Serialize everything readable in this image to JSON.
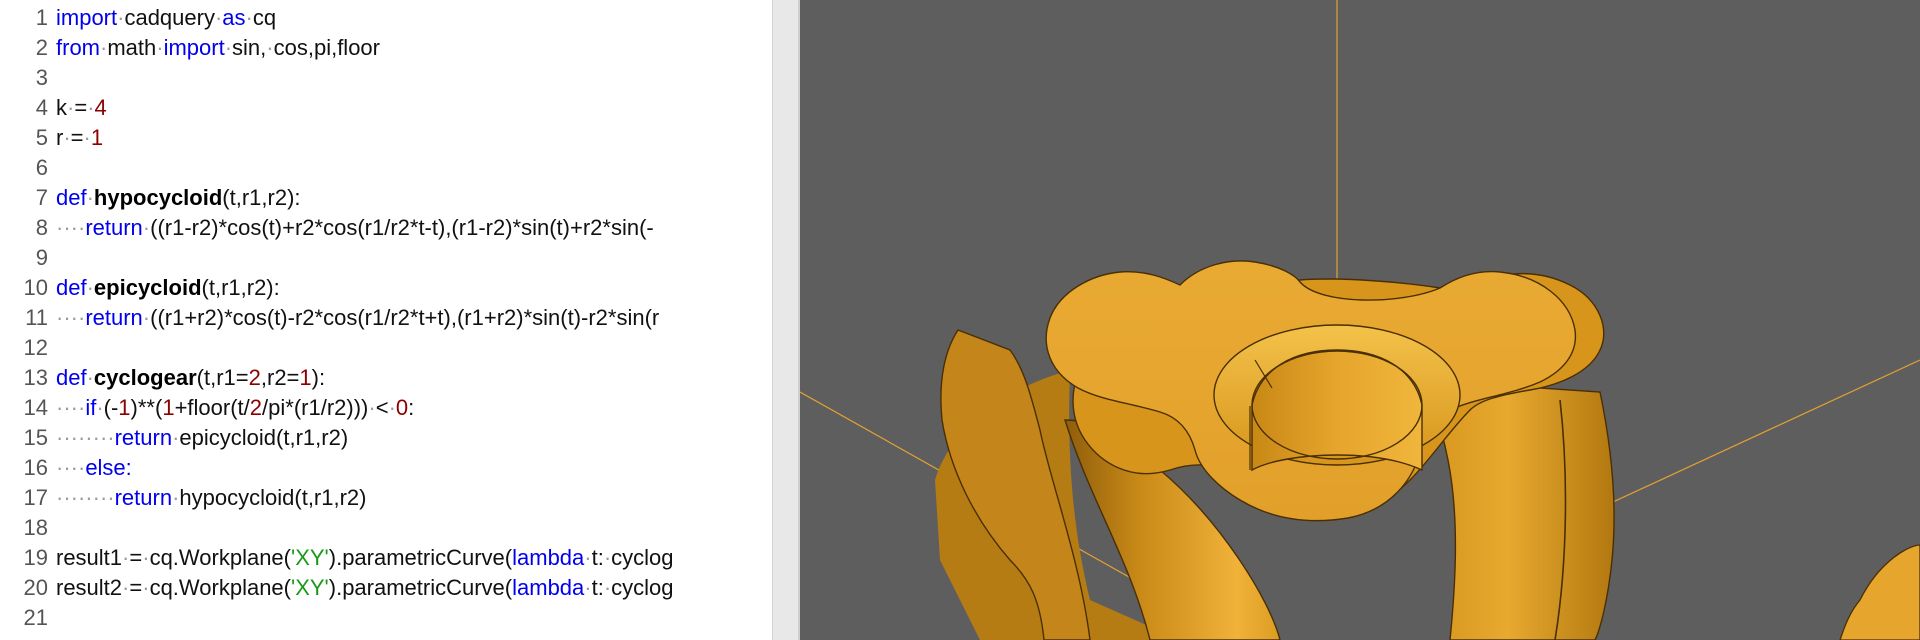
{
  "editor": {
    "lines": [
      {
        "num": "1",
        "tokens": [
          {
            "t": "import",
            "c": "kw"
          },
          {
            "t": "·",
            "c": "dot"
          },
          {
            "t": "cadquery"
          },
          {
            "t": "·",
            "c": "dot"
          },
          {
            "t": "as",
            "c": "kw"
          },
          {
            "t": "·",
            "c": "dot"
          },
          {
            "t": "cq"
          }
        ]
      },
      {
        "num": "2",
        "tokens": [
          {
            "t": "from",
            "c": "kw"
          },
          {
            "t": "·",
            "c": "dot"
          },
          {
            "t": "math"
          },
          {
            "t": "·",
            "c": "dot"
          },
          {
            "t": "import",
            "c": "kw"
          },
          {
            "t": "·",
            "c": "dot"
          },
          {
            "t": "sin,"
          },
          {
            "t": "·",
            "c": "dot"
          },
          {
            "t": "cos,pi,floor"
          }
        ]
      },
      {
        "num": "3",
        "tokens": []
      },
      {
        "num": "4",
        "tokens": [
          {
            "t": "k"
          },
          {
            "t": "·",
            "c": "dot"
          },
          {
            "t": "="
          },
          {
            "t": "·",
            "c": "dot"
          },
          {
            "t": "4",
            "c": "num"
          }
        ]
      },
      {
        "num": "5",
        "tokens": [
          {
            "t": "r"
          },
          {
            "t": "·",
            "c": "dot"
          },
          {
            "t": "="
          },
          {
            "t": "·",
            "c": "dot"
          },
          {
            "t": "1",
            "c": "num"
          }
        ]
      },
      {
        "num": "6",
        "tokens": []
      },
      {
        "num": "7",
        "tokens": [
          {
            "t": "def",
            "c": "kw"
          },
          {
            "t": "·",
            "c": "dot"
          },
          {
            "t": "hypocycloid",
            "c": "fn"
          },
          {
            "t": "(t,r1,r2):"
          }
        ]
      },
      {
        "num": "8",
        "tokens": [
          {
            "t": "····",
            "c": "dot"
          },
          {
            "t": "return",
            "c": "kw"
          },
          {
            "t": "·",
            "c": "dot"
          },
          {
            "t": "((r1-r2)*cos(t)+r2*cos(r1/r2*t-t),(r1-r2)*sin(t)+r2*sin(-"
          }
        ]
      },
      {
        "num": "9",
        "tokens": []
      },
      {
        "num": "10",
        "tokens": [
          {
            "t": "def",
            "c": "kw"
          },
          {
            "t": "·",
            "c": "dot"
          },
          {
            "t": "epicycloid",
            "c": "fn"
          },
          {
            "t": "(t,r1,r2):"
          }
        ]
      },
      {
        "num": "11",
        "tokens": [
          {
            "t": "····",
            "c": "dot"
          },
          {
            "t": "return",
            "c": "kw"
          },
          {
            "t": "·",
            "c": "dot"
          },
          {
            "t": "((r1+r2)*cos(t)-r2*cos(r1/r2*t+t),(r1+r2)*sin(t)-r2*sin(r"
          }
        ]
      },
      {
        "num": "12",
        "tokens": []
      },
      {
        "num": "13",
        "tokens": [
          {
            "t": "def",
            "c": "kw"
          },
          {
            "t": "·",
            "c": "dot"
          },
          {
            "t": "cyclogear",
            "c": "fn"
          },
          {
            "t": "(t,r1="
          },
          {
            "t": "2",
            "c": "num"
          },
          {
            "t": ",r2="
          },
          {
            "t": "1",
            "c": "num"
          },
          {
            "t": "):"
          }
        ]
      },
      {
        "num": "14",
        "tokens": [
          {
            "t": "····",
            "c": "dot"
          },
          {
            "t": "if",
            "c": "kw"
          },
          {
            "t": "·",
            "c": "dot"
          },
          {
            "t": "(-"
          },
          {
            "t": "1",
            "c": "num"
          },
          {
            "t": ")**("
          },
          {
            "t": "1",
            "c": "num"
          },
          {
            "t": "+floor(t/"
          },
          {
            "t": "2",
            "c": "num"
          },
          {
            "t": "/pi*(r1/r2)))"
          },
          {
            "t": "·",
            "c": "dot"
          },
          {
            "t": "<"
          },
          {
            "t": "·",
            "c": "dot"
          },
          {
            "t": "0",
            "c": "num"
          },
          {
            "t": ":"
          }
        ]
      },
      {
        "num": "15",
        "tokens": [
          {
            "t": "········",
            "c": "dot"
          },
          {
            "t": "return",
            "c": "kw"
          },
          {
            "t": "·",
            "c": "dot"
          },
          {
            "t": "epicycloid(t,r1,r2)"
          }
        ]
      },
      {
        "num": "16",
        "tokens": [
          {
            "t": "····",
            "c": "dot"
          },
          {
            "t": "else:",
            "c": "kw"
          }
        ]
      },
      {
        "num": "17",
        "tokens": [
          {
            "t": "········",
            "c": "dot"
          },
          {
            "t": "return",
            "c": "kw"
          },
          {
            "t": "·",
            "c": "dot"
          },
          {
            "t": "hypocycloid(t,r1,r2)"
          }
        ]
      },
      {
        "num": "18",
        "tokens": []
      },
      {
        "num": "19",
        "tokens": [
          {
            "t": "result1"
          },
          {
            "t": "·",
            "c": "dot"
          },
          {
            "t": "="
          },
          {
            "t": "·",
            "c": "dot"
          },
          {
            "t": "cq.Workplane("
          },
          {
            "t": "'XY'",
            "c": "str"
          },
          {
            "t": ").parametricCurve("
          },
          {
            "t": "lambda",
            "c": "kw"
          },
          {
            "t": "·",
            "c": "dot"
          },
          {
            "t": "t:"
          },
          {
            "t": "·",
            "c": "dot"
          },
          {
            "t": "cyclog"
          }
        ]
      },
      {
        "num": "20",
        "tokens": [
          {
            "t": "result2"
          },
          {
            "t": "·",
            "c": "dot"
          },
          {
            "t": "="
          },
          {
            "t": "·",
            "c": "dot"
          },
          {
            "t": "cq.Workplane("
          },
          {
            "t": "'XY'",
            "c": "str"
          },
          {
            "t": ").parametricCurve("
          },
          {
            "t": "lambda",
            "c": "kw"
          },
          {
            "t": "·",
            "c": "dot"
          },
          {
            "t": "t:"
          },
          {
            "t": "·",
            "c": "dot"
          },
          {
            "t": "cyclog"
          }
        ]
      },
      {
        "num": "21",
        "tokens": []
      }
    ]
  },
  "viewport": {
    "background_color": "#5e5e5e",
    "model_color": "#d9981f",
    "axis_color": "#e3a033"
  }
}
